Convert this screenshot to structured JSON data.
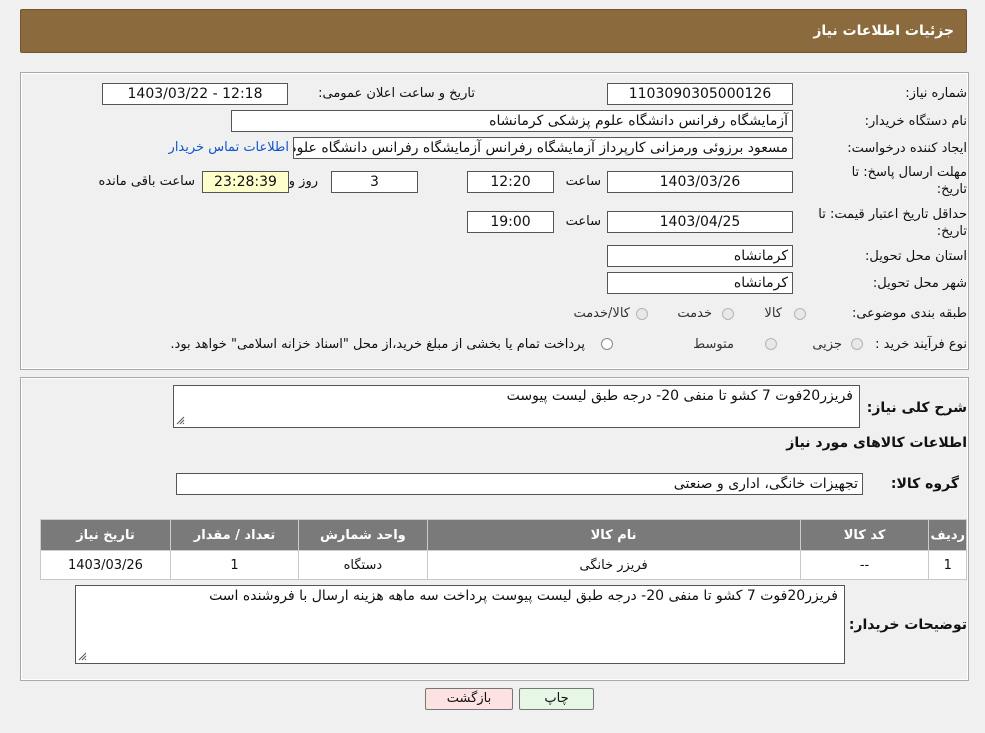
{
  "header": {
    "title": "جزئیات اطلاعات نیاز"
  },
  "info": {
    "need_number_label": "شماره نیاز:",
    "need_number": "1103090305000126",
    "announce_label": "تاریخ و ساعت اعلان عمومی:",
    "announce_value": "1403/03/22 - 12:18",
    "buyer_org_label": "نام دستگاه خریدار:",
    "buyer_org": "آزمایشگاه رفرانس دانشگاه علوم پزشکی کرمانشاه",
    "creator_label": "ایجاد کننده درخواست:",
    "creator": "مسعود برزوئی ورمزانی کارپرداز آزمایشگاه رفرانس آزمایشگاه رفرانس دانشگاه علوم پزشکی کرمانشاه",
    "contact_link": "اطلاعات تماس خریدار",
    "deadline_label_1": "مهلت ارسال پاسخ: تا",
    "deadline_label_2": "تاریخ:",
    "deadline_date": "1403/03/26",
    "time_label": "ساعت",
    "deadline_time": "12:20",
    "days_value": "3",
    "days_label": "روز و",
    "remaining_time": "23:28:39",
    "remaining_label": "ساعت باقی مانده",
    "validity_label_1": "حداقل تاریخ اعتبار قیمت: تا",
    "validity_label_2": "تاریخ:",
    "validity_date": "1403/04/25",
    "validity_time_label": "ساعت",
    "validity_time": "19:00",
    "province_label": "استان محل تحویل:",
    "province": "کرمانشاه",
    "city_label": "شهر محل تحویل:",
    "city": "کرمانشاه",
    "category_label": "طبقه بندی موضوعی:",
    "category_options": [
      "کالا",
      "خدمت",
      "کالا/خدمت"
    ],
    "process_label": "نوع فرآیند خرید :",
    "process_options": [
      "جزیی",
      "متوسط"
    ],
    "process_note": "پرداخت تمام یا بخشی از مبلغ خرید،از محل \"اسناد خزانه اسلامی\" خواهد بود."
  },
  "description": {
    "label": "شرح کلی نیاز:",
    "text": "فریزر20فوت 7 کشو تا منفی 20- درجه طبق لیست پیوست"
  },
  "goods": {
    "section_title": "اطلاعات کالاهای مورد نیاز",
    "group_label": "گروه کالا:",
    "group_value": "تجهیزات خانگی، اداری و صنعتی",
    "columns": [
      "ردیف",
      "کد کالا",
      "نام کالا",
      "واحد شمارش",
      "تعداد / مقدار",
      "تاریخ نیاز"
    ],
    "rows": [
      [
        "1",
        "--",
        "فریزر خانگی",
        "دستگاه",
        "1",
        "1403/03/26"
      ]
    ]
  },
  "buyer_notes": {
    "label": "توضیحات خریدار:",
    "text": "فریزر20فوت 7 کشو تا منفی 20- درجه طبق لیست پیوست پرداخت سه ماهه هزینه ارسال با فروشنده است"
  },
  "buttons": {
    "print": "چاپ",
    "back": "بازگشت"
  },
  "colors": {
    "header_bg": "#8b6b3d",
    "table_header_bg": "#7a7a7a",
    "back_btn_bg": "#fde2e2",
    "print_btn_bg": "#e6f7e6"
  }
}
